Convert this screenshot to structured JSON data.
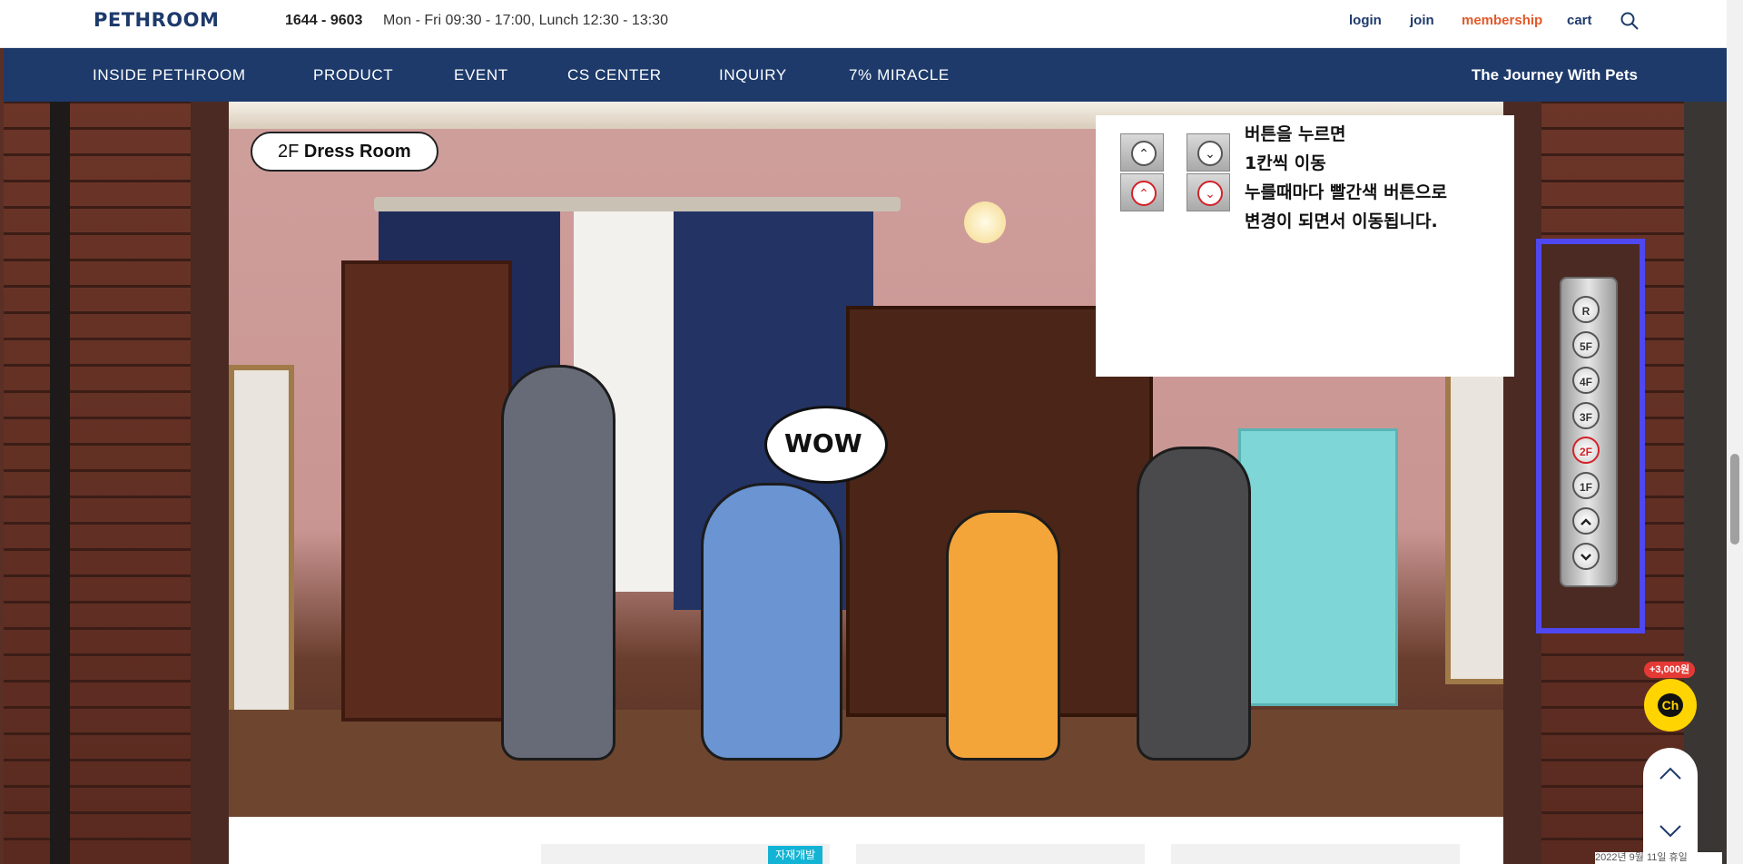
{
  "header": {
    "logo": "PETHROOM",
    "phone": "1644 - 9603",
    "hours": "Mon - Fri 09:30 - 17:00, Lunch 12:30 - 13:30",
    "links": {
      "login": "login",
      "join": "join",
      "membership": "membership",
      "cart": "cart"
    },
    "search_icon": "search-icon"
  },
  "nav": {
    "items": [
      {
        "label": "INSIDE PETHROOM"
      },
      {
        "label": "PRODUCT"
      },
      {
        "label": "EVENT"
      },
      {
        "label": "CS CENTER"
      },
      {
        "label": "INQUIRY"
      },
      {
        "label": "7% MIRACLE"
      }
    ],
    "tagline": "The Journey With Pets"
  },
  "room": {
    "floor": "2F",
    "name": "Dress Room",
    "speech": "WOW"
  },
  "instructions": {
    "lines": [
      "버튼을 누르면",
      "1칸씩 이동",
      "누를때마다 빨간색 버튼으로",
      "변경이 되면서 이동됩니다."
    ]
  },
  "elevator": {
    "floors": [
      "R",
      "5F",
      "4F",
      "3F",
      "2F",
      "1F"
    ],
    "active_floor": "2F",
    "up_icon": "chevron-up-icon",
    "down_icon": "chevron-down-icon"
  },
  "channel_talk": {
    "badge": "+3,000원",
    "label": "Ch"
  },
  "content": {
    "tag": "자재개발",
    "date_stub": "2022년 9월 11일 휴일"
  },
  "colors": {
    "brand_navy": "#1d3a6b",
    "membership": "#e05a2b",
    "elevator_frame": "#4f48f0",
    "active_red": "#d2232a",
    "channel_yellow": "#ffd400"
  }
}
